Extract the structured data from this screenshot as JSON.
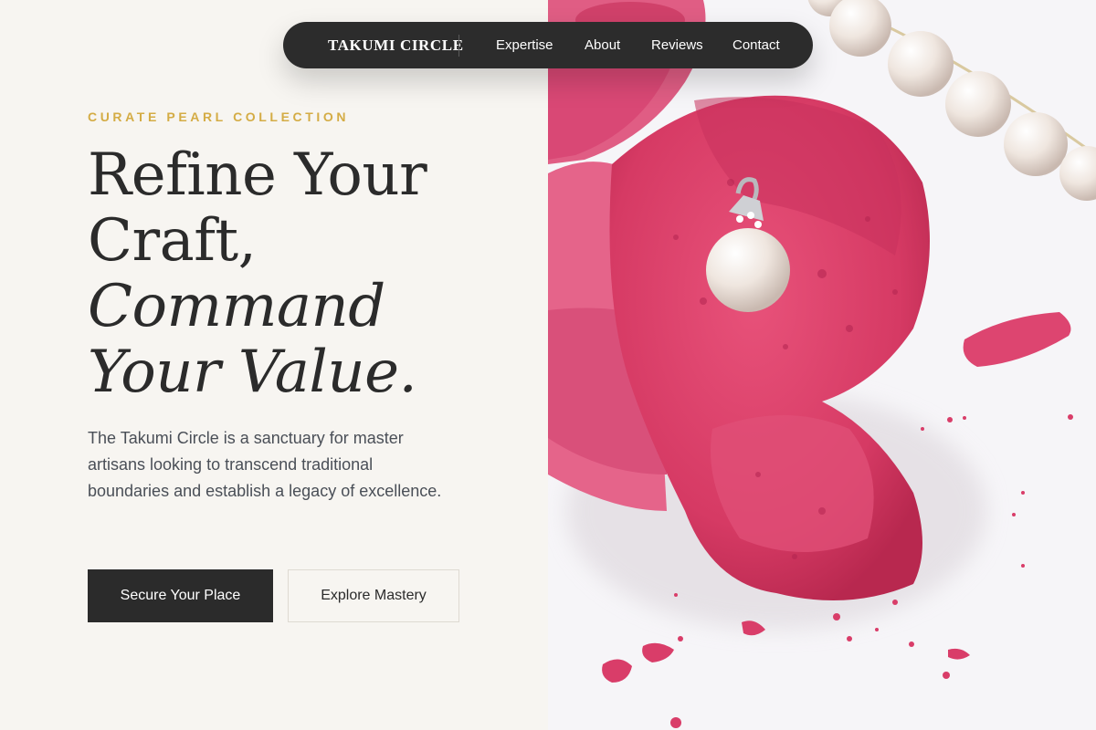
{
  "nav": {
    "brand": "TAKUMI CIRCLE",
    "links": [
      "Expertise",
      "About",
      "Reviews",
      "Contact"
    ]
  },
  "hero": {
    "eyebrow": "CURATE PEARL COLLECTION",
    "headline": {
      "line1": "Refine Your",
      "line2": "Craft,",
      "line3": "Command",
      "line4": "Your Value."
    },
    "description": "The Takumi Circle is a sanctuary for master artisans looking to transcend traditional boundaries and establish a legacy of excellence.",
    "primary_cta": "Secure Your Place",
    "secondary_cta": "Explore Mastery"
  },
  "photo": {
    "subject": "broken pink macaron with pearl pendant and pearl necklace"
  },
  "colors": {
    "accent": "#d4ac45",
    "dark": "#2b2b2b",
    "background": "#f7f5f1",
    "macaron": "#e0456e"
  }
}
